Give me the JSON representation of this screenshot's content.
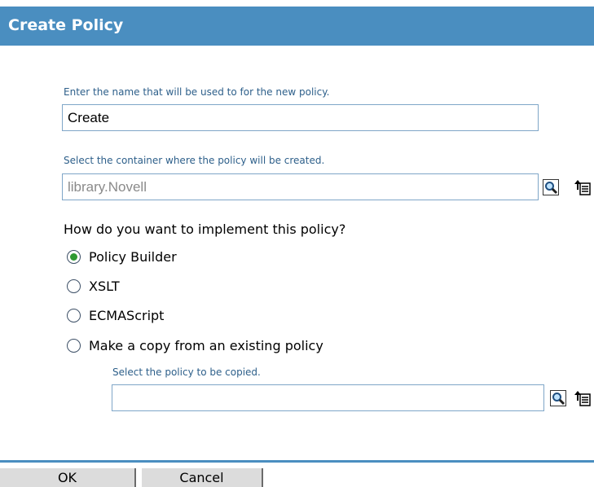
{
  "dialog": {
    "title": "Create Policy"
  },
  "name_field": {
    "hint": "Enter the name that will be used to for the new policy.",
    "value": "Create"
  },
  "container_field": {
    "hint": "Select the container where the policy will be created.",
    "value": "library.Novell"
  },
  "implementation": {
    "question": "How do you want to implement this policy?",
    "selected": "Policy Builder",
    "options": [
      {
        "label": "Policy Builder"
      },
      {
        "label": "XSLT"
      },
      {
        "label": "ECMAScript"
      },
      {
        "label": "Make a copy from an existing policy"
      }
    ]
  },
  "copy_field": {
    "hint": "Select the policy to be copied.",
    "value": ""
  },
  "icons": {
    "browse": "search-icon",
    "tree": "tree-browse-icon"
  },
  "colors": {
    "header": "#4a8ec0",
    "hint_text": "#2d5f8a",
    "radio_selected": "#2f9a32"
  },
  "buttons": {
    "ok": "OK",
    "cancel": "Cancel"
  }
}
